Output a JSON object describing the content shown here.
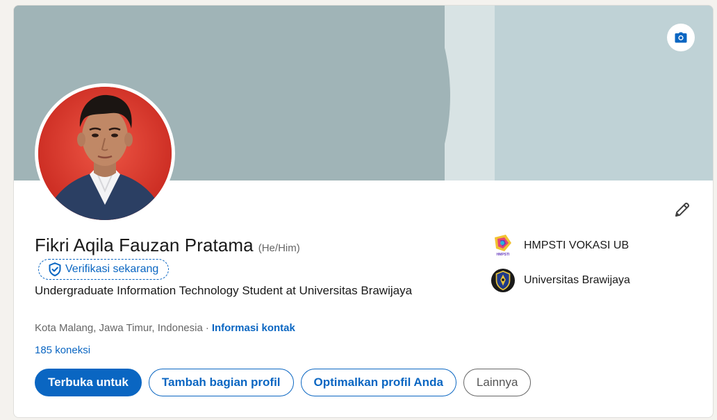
{
  "profile": {
    "name": "Fikri Aqila Fauzan Pratama",
    "pronouns": "(He/Him)",
    "verify_label": "Verifikasi sekarang",
    "headline": "Undergraduate Information Technology Student at Universitas Brawijaya",
    "location": "Kota Malang, Jawa Timur, Indonesia",
    "separator": "·",
    "contact_info": "Informasi kontak",
    "connections": "185 koneksi"
  },
  "actions": {
    "open_to": "Terbuka untuk",
    "add_section": "Tambah bagian profil",
    "optimize": "Optimalkan profil Anda",
    "more": "Lainnya"
  },
  "organizations": [
    {
      "name": "HMPSTI VOKASI UB",
      "icon": "hmpsti-logo-icon"
    },
    {
      "name": "Universitas Brawijaya",
      "icon": "ub-logo-icon"
    }
  ],
  "logo_text": {
    "hmpsti": "HMPSTI"
  },
  "icons": {
    "camera": "camera-icon",
    "edit": "pencil-icon",
    "verify": "shield-check-icon"
  },
  "colors": {
    "accent": "#0a66c2",
    "banner": "#a0b4b7",
    "banner_light": "#bfd2d6",
    "avatar_bg": "#d8302a"
  }
}
